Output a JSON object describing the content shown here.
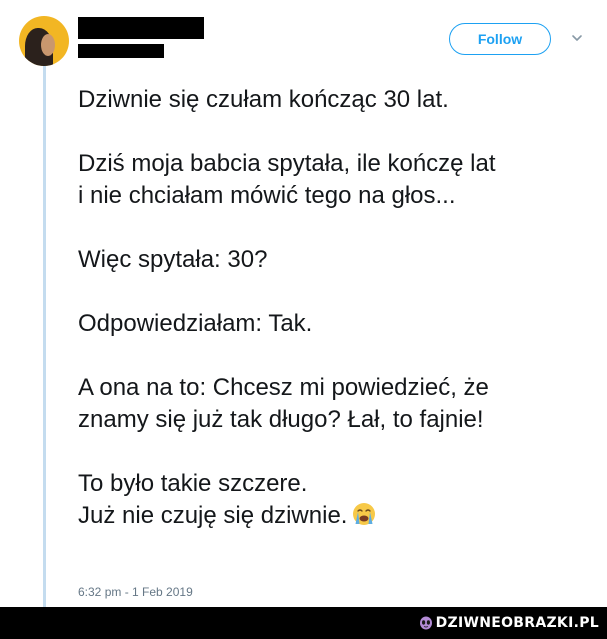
{
  "tweet": {
    "follow_label": "Follow",
    "lines": [
      "Dziwnie się czułam kończąc 30 lat.",
      "",
      "Dziś moja babcia spytała, ile kończę lat",
      "i nie chciałam mówić tego na głos...",
      "",
      "Więc spytała: 30?",
      "",
      "Odpowiedziałam: Tak.",
      "",
      "A ona na to: Chcesz mi powiedzieć, że",
      "znamy się już tak długo? Łał, to fajnie!",
      "",
      "To było takie szczere.",
      "Już nie czuję się dziwnie."
    ],
    "emoji": "loudly-crying-face-icon",
    "timestamp": "6:32 pm - 1 Feb 2019"
  },
  "watermark": {
    "text": "DZIWNEOBRAZKI.PL",
    "logo_icon": "alien-face-icon"
  },
  "colors": {
    "accent": "#1da1f2",
    "thread_line": "#c4dcef",
    "text": "#14171a",
    "muted": "#657786",
    "watermark_bar": "#000000"
  }
}
